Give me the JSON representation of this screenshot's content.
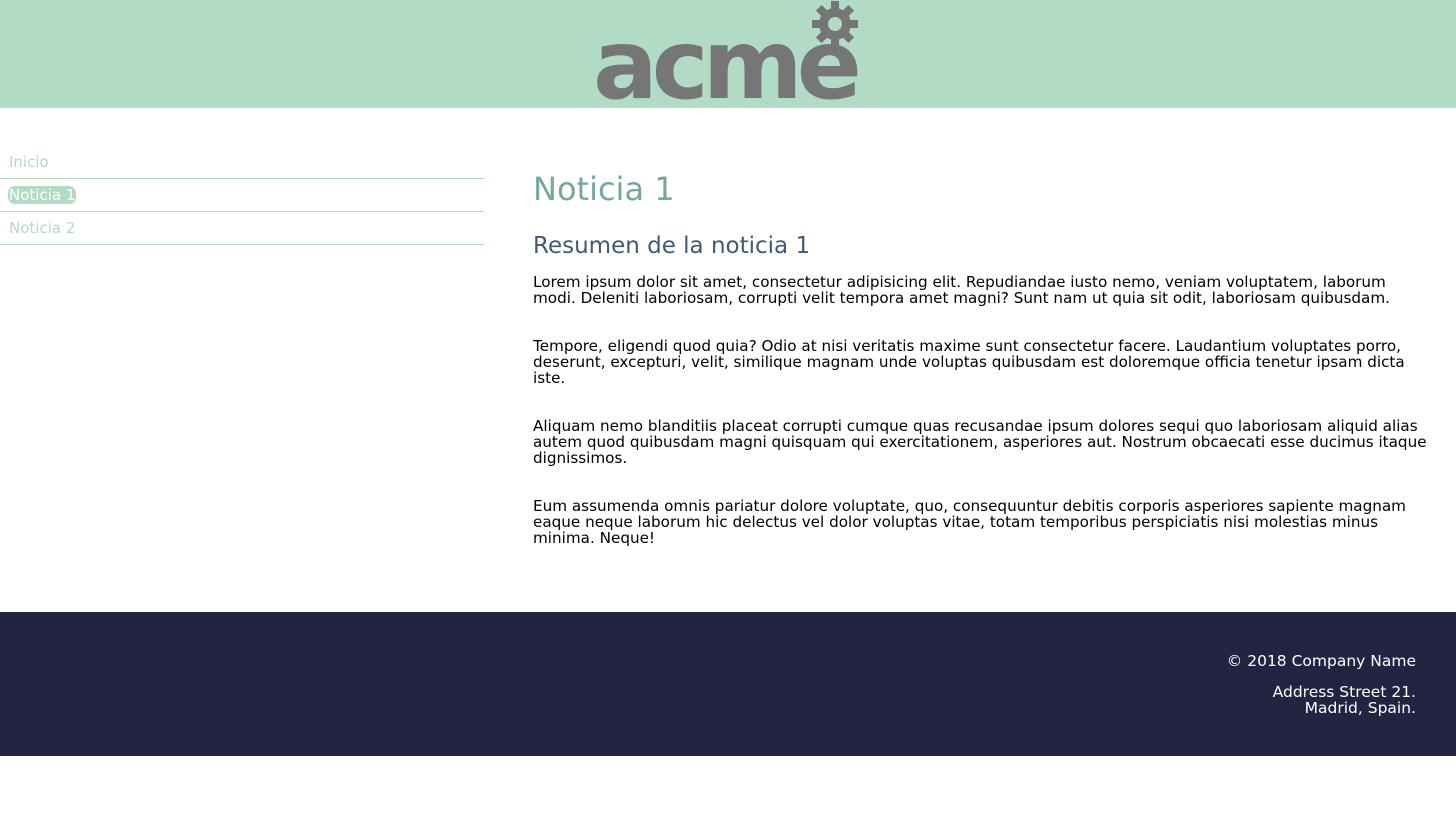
{
  "brand": {
    "logo_text": "acme",
    "header_color": "#b1dbc5",
    "logo_color": "#767676"
  },
  "nav": {
    "items": [
      {
        "label": "Inicio",
        "active": false
      },
      {
        "label": "Noticia 1",
        "active": true
      },
      {
        "label": "Noticia 2",
        "active": false
      }
    ]
  },
  "article": {
    "title": "Noticia 1",
    "subtitle": "Resumen de la noticia 1",
    "paragraphs": [
      "Lorem ipsum dolor sit amet, consectetur adipisicing elit. Repudiandae iusto nemo, veniam voluptatem, laborum modi. Deleniti laboriosam, corrupti velit tempora amet magni? Sunt nam ut quia sit odit, laboriosam quibusdam.",
      "Tempore, eligendi quod quia? Odio at nisi veritatis maxime sunt consectetur facere. Laudantium voluptates porro, deserunt, excepturi, velit, similique magnam unde voluptas quibusdam est doloremque officia tenetur ipsam dicta iste.",
      "Aliquam nemo blanditiis placeat corrupti cumque quas recusandae ipsum dolores sequi quo laboriosam aliquid alias autem quod quibusdam magni quisquam qui exercitationem, asperiores aut. Nostrum obcaecati esse ducimus itaque dignissimos.",
      "Eum assumenda omnis pariatur dolore voluptate, quo, consequuntur debitis corporis asperiores sapiente magnam eaque neque laborum hic delectus vel dolor voluptas vitae, totam temporibus perspiciatis nisi molestias minus minima. Neque!"
    ]
  },
  "footer": {
    "copyright": "© 2018 Company Name",
    "address_line1": "Address Street 21.",
    "address_line2": "Madrid, Spain.",
    "background": "#232342"
  }
}
